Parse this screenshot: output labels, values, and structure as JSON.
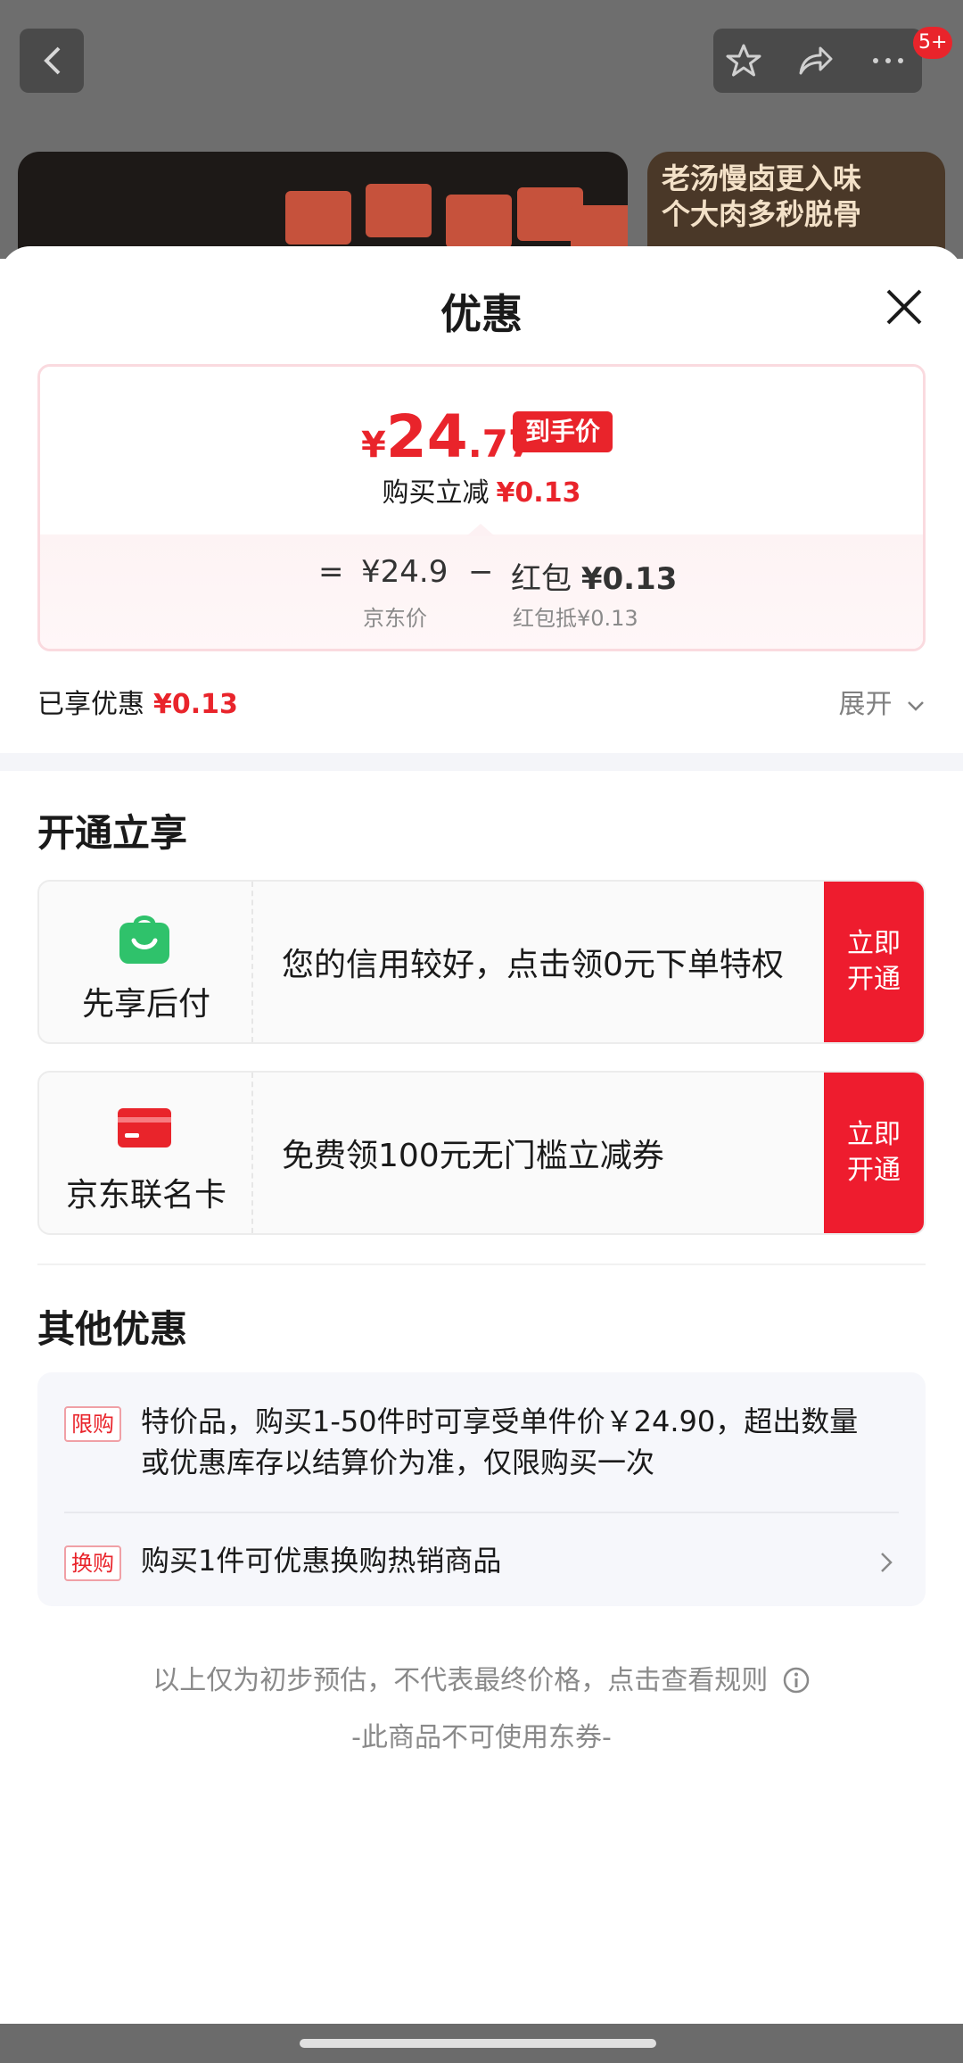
{
  "background": {
    "badge_count": "5+",
    "banner_text_line1": "老汤慢卤更入味",
    "banner_text_line2": "个大肉多秒脱骨"
  },
  "sheet": {
    "title": "优惠"
  },
  "price_card": {
    "final_currency": "¥",
    "final_int": "24",
    "final_dec": ".77",
    "final_tag": "到手价",
    "save_label": "购买立减",
    "save_amount": "¥0.13",
    "eq_sign": "=",
    "jd_price": "¥24.9",
    "jd_price_label": "京东价",
    "minus_sign": "−",
    "redpack_label": "红包",
    "redpack_amount": "¥0.13",
    "redpack_sub": "红包抵¥0.13"
  },
  "enjoyed": {
    "label": "已享优惠",
    "amount": "¥0.13",
    "expand_label": "展开"
  },
  "open_section": {
    "title": "开通立享",
    "offers": [
      {
        "name": "先享后付",
        "desc": "您的信用较好，点击领0元下单特权",
        "button_line1": "立即",
        "button_line2": "开通",
        "icon": "shopping-bag-icon",
        "color": "#2fc26b"
      },
      {
        "name": "京东联名卡",
        "desc": "免费领100元无门槛立减券",
        "button_line1": "立即",
        "button_line2": "开通",
        "icon": "credit-card-icon",
        "color": "#e9242b"
      }
    ]
  },
  "other_section": {
    "title": "其他优惠",
    "items": [
      {
        "tag": "限购",
        "line1": "特价品，购买1-50件时可享受单件价￥24.90，超出数量",
        "line2": "或优惠库存以结算价为准，仅限购买一次"
      },
      {
        "tag": "换购",
        "line1": "购买1件可优惠换购热销商品"
      }
    ]
  },
  "notes": {
    "estimate": "以上仅为初步预估，不代表最终价格，点击查看规则",
    "no_coupon": "-此商品不可使用东券-"
  },
  "colors": {
    "accent_red": "#e9242b",
    "green": "#2fc26b"
  }
}
